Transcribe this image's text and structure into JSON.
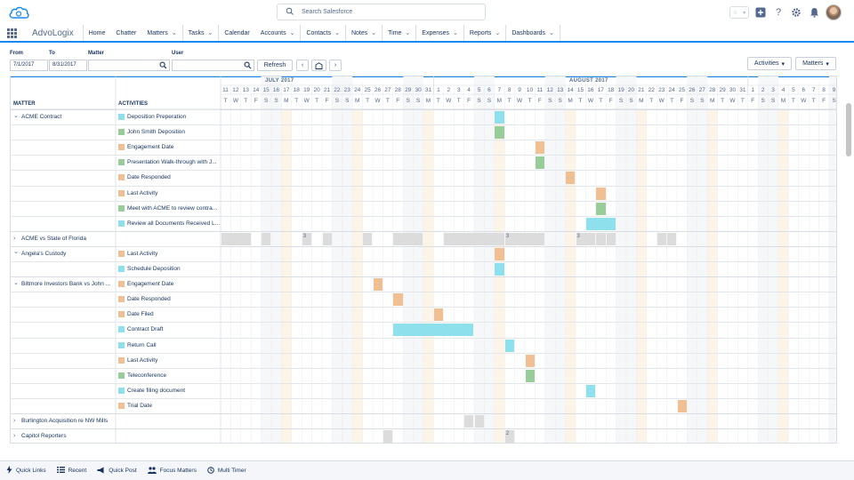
{
  "app": {
    "name": "AdvoLogix"
  },
  "search": {
    "placeholder": "Search Salesforce"
  },
  "nav": [
    {
      "label": "Home",
      "dropdown": false
    },
    {
      "label": "Chatter",
      "dropdown": false
    },
    {
      "label": "Matters",
      "dropdown": true
    },
    {
      "label": "Tasks",
      "dropdown": true
    },
    {
      "label": "Calendar",
      "dropdown": false
    },
    {
      "label": "Accounts",
      "dropdown": true
    },
    {
      "label": "Contacts",
      "dropdown": true
    },
    {
      "label": "Notes",
      "dropdown": true
    },
    {
      "label": "Time",
      "dropdown": true
    },
    {
      "label": "Expenses",
      "dropdown": true
    },
    {
      "label": "Reports",
      "dropdown": true
    },
    {
      "label": "Dashboards",
      "dropdown": true
    }
  ],
  "filters": {
    "from_label": "From",
    "from_value": "7/1/2017",
    "to_label": "To",
    "to_value": "8/31/2017",
    "matter_label": "Matter",
    "matter_value": "",
    "user_label": "User",
    "user_value": "",
    "refresh_label": "Refresh",
    "activities_label": "Activities",
    "matters_label": "Matters"
  },
  "gantt": {
    "matter_header": "MATTER",
    "activities_header": "ACTIVITIES",
    "months": [
      "JULY 2017",
      "AUGUST 2017"
    ],
    "days": [
      [
        "11",
        "T"
      ],
      [
        "12",
        "W"
      ],
      [
        "13",
        "T"
      ],
      [
        "14",
        "F"
      ],
      [
        "15",
        "S"
      ],
      [
        "16",
        "S"
      ],
      [
        "17",
        "M"
      ],
      [
        "18",
        "T"
      ],
      [
        "19",
        "W"
      ],
      [
        "20",
        "T"
      ],
      [
        "21",
        "F"
      ],
      [
        "22",
        "S"
      ],
      [
        "23",
        "S"
      ],
      [
        "24",
        "M"
      ],
      [
        "25",
        "T"
      ],
      [
        "26",
        "W"
      ],
      [
        "27",
        "T"
      ],
      [
        "28",
        "F"
      ],
      [
        "29",
        "S"
      ],
      [
        "30",
        "S"
      ],
      [
        "31",
        "M"
      ],
      [
        "1",
        "T"
      ],
      [
        "2",
        "W"
      ],
      [
        "3",
        "T"
      ],
      [
        "4",
        "F"
      ],
      [
        "5",
        "S"
      ],
      [
        "6",
        "S"
      ],
      [
        "7",
        "M"
      ],
      [
        "8",
        "T"
      ],
      [
        "9",
        "W"
      ],
      [
        "10",
        "T"
      ],
      [
        "11",
        "F"
      ],
      [
        "12",
        "S"
      ],
      [
        "13",
        "S"
      ],
      [
        "14",
        "M"
      ],
      [
        "15",
        "T"
      ],
      [
        "16",
        "W"
      ],
      [
        "17",
        "T"
      ],
      [
        "18",
        "F"
      ],
      [
        "19",
        "S"
      ],
      [
        "20",
        "S"
      ],
      [
        "21",
        "M"
      ],
      [
        "22",
        "T"
      ],
      [
        "23",
        "W"
      ],
      [
        "24",
        "T"
      ],
      [
        "25",
        "F"
      ],
      [
        "26",
        "S"
      ],
      [
        "27",
        "S"
      ],
      [
        "28",
        "M"
      ],
      [
        "29",
        "T"
      ],
      [
        "30",
        "W"
      ],
      [
        "31",
        "T"
      ],
      [
        "1",
        "F"
      ],
      [
        "2",
        "S"
      ],
      [
        "3",
        "S"
      ],
      [
        "4",
        "M"
      ],
      [
        "5",
        "T"
      ],
      [
        "6",
        "W"
      ],
      [
        "7",
        "T"
      ],
      [
        "8",
        "F"
      ],
      [
        "9",
        "S"
      ]
    ],
    "rows": [
      {
        "matter": "ACME Contract",
        "expanded": true,
        "activity": "Deposition Preperation",
        "color": "#8ee0ec",
        "bars": [
          {
            "d": 27,
            "w": 1
          }
        ]
      },
      {
        "matter": "",
        "activity": "John Smith Deposition",
        "color": "#98cc98",
        "bars": [
          {
            "d": 27,
            "w": 1
          }
        ]
      },
      {
        "matter": "",
        "activity": "Engagement Date",
        "color": "#f0c094",
        "bars": [
          {
            "d": 31,
            "w": 1
          }
        ]
      },
      {
        "matter": "",
        "activity": "Presentation Walk-through with J...",
        "color": "#98cc98",
        "bars": [
          {
            "d": 31,
            "w": 1
          }
        ]
      },
      {
        "matter": "",
        "activity": "Date Responded",
        "color": "#f0c094",
        "bars": [
          {
            "d": 34,
            "w": 1
          }
        ]
      },
      {
        "matter": "",
        "activity": "Last Activity",
        "color": "#f0c094",
        "bars": [
          {
            "d": 37,
            "w": 1
          }
        ]
      },
      {
        "matter": "",
        "activity": "Meet with ACME to review contra...",
        "color": "#98cc98",
        "bars": [
          {
            "d": 37,
            "w": 1
          }
        ]
      },
      {
        "matter": "",
        "activity": "Review all Documents Received L...",
        "color": "#8ee0ec",
        "bars": [
          {
            "d": 36,
            "w": 3
          }
        ]
      },
      {
        "matter": "ACME vs State of Florida",
        "expanded": false,
        "activity": "",
        "color": "",
        "bars": [
          {
            "d": 0,
            "w": 3,
            "g": true
          },
          {
            "d": 4,
            "w": 1,
            "g": true
          },
          {
            "d": 8,
            "w": 1,
            "g": true,
            "t": "3"
          },
          {
            "d": 10,
            "w": 1,
            "g": true
          },
          {
            "d": 14,
            "w": 1,
            "g": true
          },
          {
            "d": 17,
            "w": 3,
            "g": true
          },
          {
            "d": 22,
            "w": 6,
            "g": true
          },
          {
            "d": 28,
            "w": 4,
            "g": true,
            "t": "3"
          },
          {
            "d": 35,
            "w": 2,
            "g": true,
            "t": "3"
          },
          {
            "d": 37,
            "w": 1,
            "g": true
          },
          {
            "d": 38,
            "w": 1,
            "g": true
          },
          {
            "d": 43,
            "w": 1,
            "g": true
          },
          {
            "d": 44,
            "w": 1,
            "g": true
          }
        ]
      },
      {
        "matter": "Angela's Custody",
        "expanded": true,
        "activity": "Last Activity",
        "color": "#f0c094",
        "bars": [
          {
            "d": 27,
            "w": 1
          }
        ]
      },
      {
        "matter": "",
        "activity": "Schedule Deposition",
        "color": "#8ee0ec",
        "bars": [
          {
            "d": 27,
            "w": 1
          }
        ]
      },
      {
        "matter": "Biltmore Investors Bank vs John ...",
        "expanded": true,
        "activity": "Engagement Date",
        "color": "#f0c094",
        "bars": [
          {
            "d": 15,
            "w": 1
          }
        ]
      },
      {
        "matter": "",
        "activity": "Date Responded",
        "color": "#f0c094",
        "bars": [
          {
            "d": 17,
            "w": 1
          }
        ]
      },
      {
        "matter": "",
        "activity": "Date Filed",
        "color": "#f0c094",
        "bars": [
          {
            "d": 21,
            "w": 1
          }
        ]
      },
      {
        "matter": "",
        "activity": "Contract Draft",
        "color": "#8ee0ec",
        "bars": [
          {
            "d": 17,
            "w": 8
          }
        ]
      },
      {
        "matter": "",
        "activity": "Return Call",
        "color": "#8ee0ec",
        "bars": [
          {
            "d": 28,
            "w": 1
          }
        ]
      },
      {
        "matter": "",
        "activity": "Last Activity",
        "color": "#f0c094",
        "bars": [
          {
            "d": 30,
            "w": 1
          }
        ]
      },
      {
        "matter": "",
        "activity": "Teleconference",
        "color": "#98cc98",
        "bars": [
          {
            "d": 30,
            "w": 1
          }
        ]
      },
      {
        "matter": "",
        "activity": "Create filing document",
        "color": "#8ee0ec",
        "bars": [
          {
            "d": 36,
            "w": 1
          }
        ]
      },
      {
        "matter": "",
        "activity": "Trial Date",
        "color": "#f0c094",
        "bars": [
          {
            "d": 45,
            "w": 1
          }
        ]
      },
      {
        "matter": "Burlington Acquisition re NW Mills",
        "expanded": false,
        "activity": "",
        "color": "",
        "bars": [
          {
            "d": 24,
            "w": 1,
            "g": true
          },
          {
            "d": 25,
            "w": 1,
            "g": true
          }
        ]
      },
      {
        "matter": "Capitol Reporters",
        "expanded": false,
        "activity": "",
        "color": "",
        "bars": [
          {
            "d": 16,
            "w": 1,
            "g": true
          },
          {
            "d": 28,
            "w": 1,
            "g": true,
            "t": "2"
          }
        ]
      }
    ]
  },
  "bottom": [
    {
      "label": "Quick Links",
      "icon": "bolt-icon"
    },
    {
      "label": "Recent",
      "icon": "list-icon"
    },
    {
      "label": "Quick Post",
      "icon": "megaphone-icon"
    },
    {
      "label": "Focus Matters",
      "icon": "people-icon"
    },
    {
      "label": "Multi Timer",
      "icon": "clock-icon"
    }
  ]
}
